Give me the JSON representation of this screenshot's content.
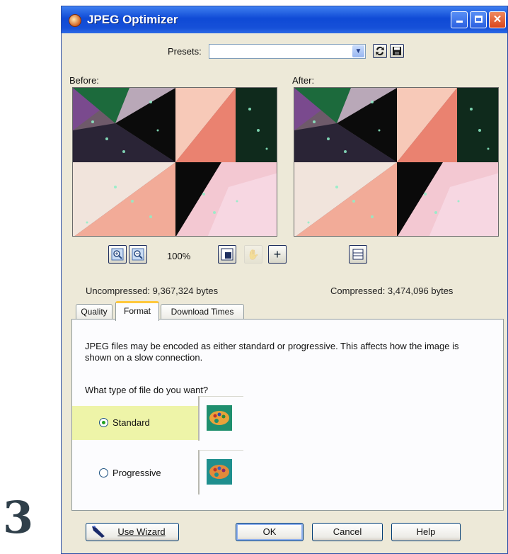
{
  "step_number": "3",
  "window": {
    "title": "JPEG Optimizer",
    "icon": "jpeg-optimizer-app-icon",
    "controls": [
      "minimize-icon",
      "maximize-icon",
      "close-icon"
    ]
  },
  "presets": {
    "label": "Presets:",
    "value": "",
    "buttons": [
      "load-preset-icon",
      "save-preset-icon"
    ]
  },
  "preview": {
    "before_label": "Before:",
    "after_label": "After:",
    "zoom_percent": "100%",
    "zoom_buttons": [
      "zoom-in-icon",
      "zoom-out-icon",
      "zoom-100-icon",
      "pan-icon",
      "move-icon",
      "proof-icon"
    ]
  },
  "sizes": {
    "uncompressed": "Uncompressed: 9,367,324 bytes",
    "compressed": "Compressed: 3,474,096 bytes"
  },
  "tabs": [
    {
      "label": "Quality",
      "active": false
    },
    {
      "label": "Format",
      "active": true
    },
    {
      "label": "Download Times",
      "active": false
    }
  ],
  "format": {
    "description": "JPEG files may be encoded as either standard or progressive. This affects how the image is shown on a slow connection.",
    "question": "What type of file do you want?",
    "options": [
      {
        "label": "Standard",
        "selected": true
      },
      {
        "label": "Progressive",
        "selected": false
      }
    ]
  },
  "buttons": {
    "wizard": "Use Wizard",
    "ok": "OK",
    "cancel": "Cancel",
    "help": "Help"
  },
  "colors": {
    "titlebar": "#0f4ad6",
    "highlight": "#eef4a8",
    "tab_accent": "#ffc83c"
  }
}
